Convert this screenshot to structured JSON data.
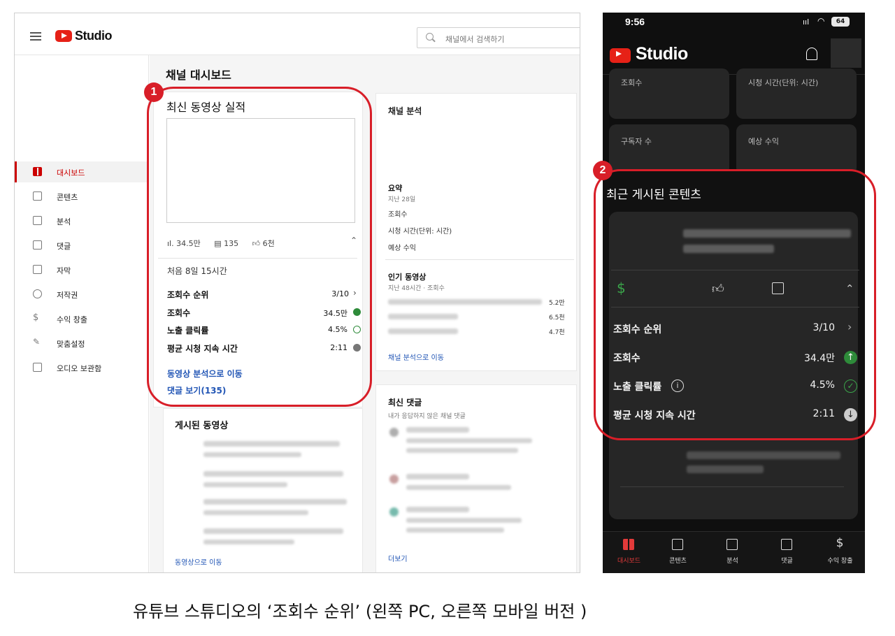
{
  "pc": {
    "app_name": "Studio",
    "search_placeholder": "채널에서 검색하기",
    "page_title": "채널 대시보드",
    "sidebar": [
      {
        "label": "대시보드",
        "icon": "dashboard-icon",
        "active": true
      },
      {
        "label": "콘텐츠",
        "icon": "content-icon"
      },
      {
        "label": "분석",
        "icon": "analytics-icon"
      },
      {
        "label": "댓글",
        "icon": "comments-icon"
      },
      {
        "label": "자막",
        "icon": "subtitles-icon"
      },
      {
        "label": "저작권",
        "icon": "copyright-icon"
      },
      {
        "label": "수익 창출",
        "icon": "monetization-icon"
      },
      {
        "label": "맞춤설정",
        "icon": "customization-icon"
      },
      {
        "label": "오디오 보관함",
        "icon": "audio-library-icon"
      }
    ],
    "latest_video": {
      "title": "최신 동영상 실적",
      "views": "34.5만",
      "comments": "135",
      "likes": "6천",
      "first_period": "처음 8일 15시간",
      "rows": [
        {
          "label": "조회수 순위",
          "value": "3/10"
        },
        {
          "label": "조회수",
          "value": "34.5만"
        },
        {
          "label": "노출 클릭률",
          "value": "4.5%"
        },
        {
          "label": "평균 시청 지속 시간",
          "value": "2:11"
        }
      ],
      "link_analytics": "동영상 분석으로 이동",
      "link_comments": "댓글 보기(135)"
    },
    "published": {
      "title": "게시된 동영상",
      "link": "동영상으로 이동"
    },
    "channel_analytics": {
      "title": "채널 분석",
      "summary": "요약",
      "summary_period": "지난 28일",
      "metrics": [
        "조회수",
        "시청 시간(단위: 시간)",
        "예상 수익"
      ],
      "popular_title": "인기 동영상",
      "popular_period": "지난 48시간 · 조회수",
      "popular_values": [
        "5.2만",
        "6.5천",
        "4.7천"
      ],
      "link": "채널 분석으로 이동"
    },
    "recent_comments": {
      "title": "최신 댓글",
      "subtitle": "내가 응답하지 않은 채널 댓글",
      "link": "더보기"
    }
  },
  "mobile": {
    "time": "9:56",
    "battery": "64",
    "app_name": "Studio",
    "stat_cards": [
      "조회수",
      "시청 시간(단위: 시간)",
      "구독자 수",
      "예상 수익"
    ],
    "section_title": "최근 게시된 콘텐츠",
    "rows": [
      {
        "label": "조회수 순위",
        "value": "3/10"
      },
      {
        "label": "조회수",
        "value": "34.4만"
      },
      {
        "label": "노출 클릭률",
        "value": "4.5%"
      },
      {
        "label": "평균 시청 지속 시간",
        "value": "2:11"
      }
    ],
    "nav": [
      "대시보드",
      "콘텐츠",
      "분석",
      "댓글",
      "수익 창출"
    ]
  },
  "badges": {
    "one": "1",
    "two": "2"
  },
  "caption": "유튜브 스튜디오의 ‘조회수 순위’  (왼쪽 PC, 오른쪽 모바일 버전 )",
  "colors": {
    "accent_red": "#d81e28",
    "youtube_red": "#e62117",
    "up_green": "#2e8b3a",
    "link_blue": "#2155b5"
  }
}
